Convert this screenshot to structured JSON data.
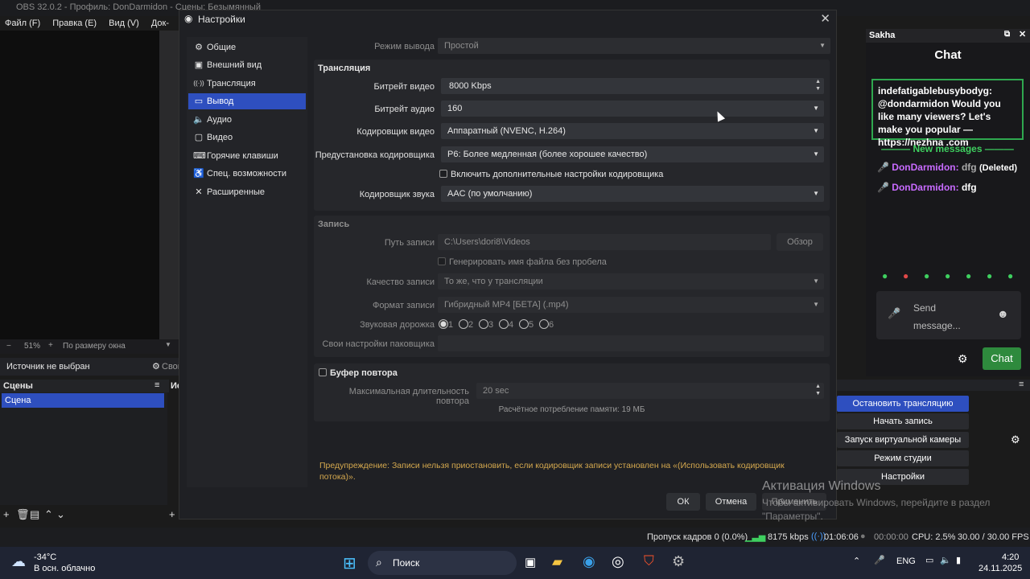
{
  "obs": {
    "title": "OBS 32.0.2 - Профиль: DonDarmidon - Сцены: Безымянный",
    "menu": [
      "Файл (F)",
      "Правка (E)",
      "Вид (V)",
      "Док-панели ("
    ],
    "zoom": "51%",
    "fit_label": "По размеру окна",
    "source_status": "Источник не выбран",
    "props_label": "Свой",
    "scenes_header": "Сцены",
    "sources_header_partial": "Ис",
    "scene_item": "Сцена"
  },
  "dialog": {
    "title": "Настройки",
    "nav": [
      {
        "label": "Общие",
        "icon": "⚙"
      },
      {
        "label": "Внешний вид",
        "icon": "▣"
      },
      {
        "label": "Трансляция",
        "icon": "((·))"
      },
      {
        "label": "Вывод",
        "icon": "▭"
      },
      {
        "label": "Аудио",
        "icon": "🔈"
      },
      {
        "label": "Видео",
        "icon": "▢"
      },
      {
        "label": "Горячие клавиши",
        "icon": "⌨"
      },
      {
        "label": "Спец. возможности",
        "icon": "♿"
      },
      {
        "label": "Расширенные",
        "icon": "✕"
      }
    ],
    "selected_nav": "Вывод",
    "output_mode_label": "Режим вывода",
    "output_mode_value": "Простой",
    "streaming": {
      "title": "Трансляция",
      "video_bitrate_label": "Битрейт видео",
      "video_bitrate_value": "8000 Kbps",
      "audio_bitrate_label": "Битрейт аудио",
      "audio_bitrate_value": "160",
      "video_encoder_label": "Кодировщик видео",
      "video_encoder_value": "Аппаратный (NVENC, H.264)",
      "preset_label": "Предустановка кодировщика",
      "preset_value": "P6: Более медленная (более хорошее качество)",
      "advanced_checkbox": "Включить дополнительные настройки кодировщика",
      "audio_encoder_label": "Кодировщик звука",
      "audio_encoder_value": "AAC (по умолчанию)"
    },
    "recording": {
      "title": "Запись",
      "path_label": "Путь записи",
      "path_value": "C:\\Users\\dori8\\Videos",
      "browse": "Обзор",
      "no_space_checkbox": "Генерировать имя файла без пробела",
      "quality_label": "Качество записи",
      "quality_value": "То же, что у трансляции",
      "format_label": "Формат записи",
      "format_value": "Гибридный MP4 [БЕТА] (.mp4)",
      "audio_track_label": "Звуковая дорожка",
      "tracks": [
        "1",
        "2",
        "3",
        "4",
        "5",
        "6"
      ],
      "muxer_label": "Свои настройки паковщика",
      "muxer_value": ""
    },
    "replay": {
      "checkbox": "Буфер повтора",
      "max_len_label": "Максимальная длительность повтора",
      "max_len_value": "20 sec",
      "memory": "Расчётное потребление памяти: 19 МБ"
    },
    "warning": "Предупреждение: Записи нельзя приостановить, если кодировщик записи установлен на «(Использовать кодировщик потока)».",
    "ok": "ОК",
    "cancel": "Отмена",
    "apply": "Применить"
  },
  "chat": {
    "dock_title": "Sakha",
    "title": "Chat",
    "pinned": "indefatigablebusybodyg: @dondarmidon Would you like many viewers? Let's make you popular — https://nezhna .com",
    "new_messages": "New messages",
    "lines": [
      {
        "user": "DonDarmidon:",
        "text": "dfg",
        "extra": "(Deleted)"
      },
      {
        "user": "DonDarmidon:",
        "text": "dfg",
        "extra": ""
      }
    ],
    "send_placeholder": "Send message...",
    "chat_button": "Chat",
    "colors": {
      "accent": "#2e8a3d",
      "user": "#c86bff",
      "new": "#3ecf5f"
    }
  },
  "controls": {
    "stop_stream": "Остановить трансляцию",
    "start_record": "Начать запись",
    "virtual_cam": "Запуск виртуальной камеры",
    "studio_mode": "Режим студии",
    "settings": "Настройки"
  },
  "statusbar": {
    "dropped": "Пропуск кадров 0 (0.0%)",
    "bitrate": "8175 kbps",
    "stream_time": "01:06:06",
    "rec_time": "00:00:00",
    "cpu": "CPU: 2.5%",
    "fps": "30.00 / 30.00 FPS"
  },
  "windows": {
    "activate_title": "Активация Windows",
    "activate_text": "Чтобы активировать Windows, перейдите в раздел \"Параметры\".",
    "weather_temp": "-34°C",
    "weather_desc": "В осн. облачно",
    "search": "Поиск",
    "lang": "ENG",
    "time": "4:20",
    "date": "24.11.2025"
  }
}
